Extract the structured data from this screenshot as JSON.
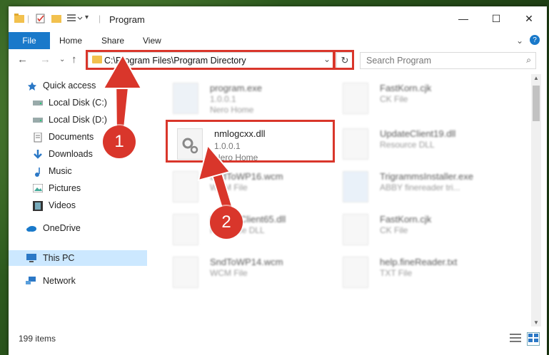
{
  "window": {
    "title": "Program",
    "minimize": "—",
    "maximize": "☐",
    "close": "✕"
  },
  "ribbon": {
    "tabs": [
      "File",
      "Home",
      "Share",
      "View"
    ],
    "help": "?",
    "expand": "⌄"
  },
  "nav": {
    "back": "←",
    "forward": "→",
    "up": "↑",
    "recent": "⌄",
    "address": "C:\\Program Files\\Program Directory",
    "dropdown": "⌄",
    "refresh": "↻",
    "search_placeholder": "Search Program",
    "search_icon": "⌕"
  },
  "sidebar": {
    "items": [
      {
        "label": "Quick access",
        "icon": "star-icon",
        "pinned": false
      },
      {
        "label": "Local Disk (C:)",
        "icon": "drive-icon",
        "pinned": true
      },
      {
        "label": "Local Disk (D:)",
        "icon": "drive-icon",
        "pinned": true
      },
      {
        "label": "Documents",
        "icon": "documents-icon",
        "pinned": true
      },
      {
        "label": "Downloads",
        "icon": "downloads-icon",
        "pinned": true
      },
      {
        "label": "Music",
        "icon": "music-icon",
        "pinned": true
      },
      {
        "label": "Pictures",
        "icon": "pictures-icon",
        "pinned": true
      },
      {
        "label": "Videos",
        "icon": "videos-icon",
        "pinned": true
      },
      {
        "label": "OneDrive",
        "icon": "cloud-icon",
        "pinned": false
      },
      {
        "label": "This PC",
        "icon": "computer-icon",
        "pinned": false,
        "selected": true
      },
      {
        "label": "Network",
        "icon": "network-icon",
        "pinned": false
      }
    ]
  },
  "files": [
    {
      "name": "program.exe",
      "line2": "1.0.0.1",
      "line3": "Nero Home",
      "blurred": true
    },
    {
      "name": "FastKorn.cjk",
      "line2": "CK File",
      "blurred": true
    },
    {
      "name": "nmlogcxx.dll",
      "line2": "1.0.0.1",
      "line3": "Nero Home",
      "blurred": false
    },
    {
      "name": "UpdateClient19.dll",
      "line2": "Resource DLL",
      "blurred": true
    },
    {
      "name": "SndToWP16.wcm",
      "line2": "WCM File",
      "blurred": true
    },
    {
      "name": "TrigrammsInstaller.exe",
      "line2": "ABBY finereader tri...",
      "blurred": true
    },
    {
      "name": "UpdateClient65.dll",
      "line2": "Resource DLL",
      "blurred": true
    },
    {
      "name": "FastKorn.cjk",
      "line2": "CK File",
      "blurred": true
    },
    {
      "name": "SndToWP14.wcm",
      "line2": "WCM File",
      "blurred": true
    },
    {
      "name": "help.fineReader.txt",
      "line2": "TXT File",
      "blurred": true
    }
  ],
  "status": {
    "count": "199 items"
  },
  "annotations": {
    "step1": "1",
    "step2": "2",
    "color": "#d9362b"
  },
  "colors": {
    "file_tab": "#1979ca",
    "selection": "#cce8ff",
    "highlight": "#d9362b"
  }
}
